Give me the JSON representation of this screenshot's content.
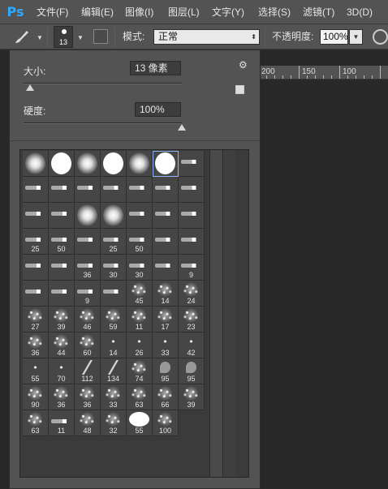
{
  "app": {
    "logo": "Ps"
  },
  "menu": [
    {
      "label": "文件(F)",
      "name": "menu-file"
    },
    {
      "label": "编辑(E)",
      "name": "menu-edit"
    },
    {
      "label": "图像(I)",
      "name": "menu-image"
    },
    {
      "label": "图层(L)",
      "name": "menu-layer"
    },
    {
      "label": "文字(Y)",
      "name": "menu-type"
    },
    {
      "label": "选择(S)",
      "name": "menu-select"
    },
    {
      "label": "滤镜(T)",
      "name": "menu-filter"
    },
    {
      "label": "3D(D)",
      "name": "menu-3d"
    }
  ],
  "options": {
    "brush_size_value": "13",
    "mode_label": "模式:",
    "mode_value": "正常",
    "opacity_label": "不透明度:",
    "opacity_value": "100%"
  },
  "ruler": {
    "ticks": [
      "200",
      "150",
      "100"
    ]
  },
  "brush_panel": {
    "size_label": "大小:",
    "size_value": "13 像素",
    "size_fraction": 0.04,
    "hardness_label": "硬度:",
    "hardness_value": "100%",
    "hardness_fraction": 1.0,
    "presets": [
      [
        "soft",
        "",
        ""
      ],
      [
        "hard",
        "",
        ""
      ],
      [
        "soft",
        "",
        ""
      ],
      [
        "hard",
        "",
        ""
      ],
      [
        "soft",
        "",
        ""
      ],
      [
        "hard",
        "",
        "sel"
      ],
      [
        "tip",
        "",
        ""
      ],
      [
        "tip",
        "",
        ""
      ],
      [
        "tip",
        "",
        ""
      ],
      [
        "tip",
        "",
        ""
      ],
      [
        "tip",
        "",
        ""
      ],
      [
        "tip",
        "",
        ""
      ],
      [
        "tip",
        "",
        ""
      ],
      [
        "tip",
        "",
        ""
      ],
      [
        "tip",
        "",
        ""
      ],
      [
        "tip",
        "",
        ""
      ],
      [
        "soft",
        "",
        ""
      ],
      [
        "soft",
        "",
        ""
      ],
      [
        "tip",
        "",
        ""
      ],
      [
        "tip",
        "",
        ""
      ],
      [
        "tip",
        "",
        ""
      ],
      [
        "tip",
        "25",
        ""
      ],
      [
        "tip",
        "50",
        ""
      ],
      [
        "tip",
        "",
        ""
      ],
      [
        "tip",
        "25",
        ""
      ],
      [
        "tip",
        "50",
        ""
      ],
      [
        "tip",
        "",
        ""
      ],
      [
        "tip",
        "",
        ""
      ],
      [
        "tip",
        "",
        ""
      ],
      [
        "tip",
        "",
        ""
      ],
      [
        "tip",
        "36",
        ""
      ],
      [
        "tip",
        "30",
        ""
      ],
      [
        "tip",
        "30",
        ""
      ],
      [
        "tip",
        "",
        ""
      ],
      [
        "tip",
        "9",
        ""
      ],
      [
        "tip",
        "",
        ""
      ],
      [
        "tip",
        "",
        ""
      ],
      [
        "tip",
        "9",
        ""
      ],
      [
        "tip",
        "",
        ""
      ],
      [
        "scatter",
        "45",
        ""
      ],
      [
        "scatter",
        "14",
        ""
      ],
      [
        "scatter",
        "24",
        ""
      ],
      [
        "scatter",
        "27",
        ""
      ],
      [
        "scatter",
        "39",
        ""
      ],
      [
        "scatter",
        "46",
        ""
      ],
      [
        "scatter",
        "59",
        ""
      ],
      [
        "scatter",
        "11",
        ""
      ],
      [
        "scatter",
        "17",
        ""
      ],
      [
        "scatter",
        "23",
        ""
      ],
      [
        "scatter",
        "36",
        ""
      ],
      [
        "scatter",
        "44",
        ""
      ],
      [
        "scatter",
        "60",
        ""
      ],
      [
        "star",
        "14",
        ""
      ],
      [
        "star",
        "26",
        ""
      ],
      [
        "star",
        "33",
        ""
      ],
      [
        "star",
        "42",
        ""
      ],
      [
        "star",
        "55",
        ""
      ],
      [
        "star",
        "70",
        ""
      ],
      [
        "stroke",
        "112",
        ""
      ],
      [
        "stroke",
        "134",
        ""
      ],
      [
        "scatter",
        "74",
        ""
      ],
      [
        "leaf",
        "95",
        ""
      ],
      [
        "leaf",
        "95",
        ""
      ],
      [
        "scatter",
        "90",
        ""
      ],
      [
        "scatter",
        "36",
        ""
      ],
      [
        "scatter",
        "36",
        ""
      ],
      [
        "scatter",
        "33",
        ""
      ],
      [
        "scatter",
        "63",
        ""
      ],
      [
        "scatter",
        "66",
        ""
      ],
      [
        "scatter",
        "39",
        ""
      ],
      [
        "scatter",
        "63",
        ""
      ],
      [
        "tip",
        "11",
        ""
      ],
      [
        "scatter",
        "48",
        ""
      ],
      [
        "scatter",
        "32",
        ""
      ],
      [
        "hard",
        "55",
        ""
      ],
      [
        "scatter",
        "100",
        ""
      ]
    ]
  },
  "colors": {
    "chrome": "#535353",
    "canvas": "#282828",
    "accent": "#31a8ff",
    "selection": "#8fb6ff"
  }
}
